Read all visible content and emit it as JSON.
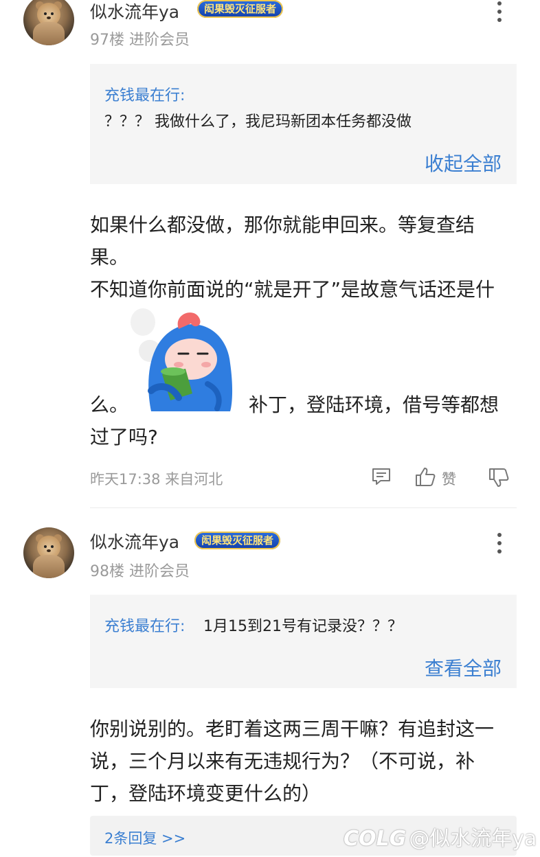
{
  "posts": [
    {
      "username": "似水流年ya",
      "badge": "闳果毁灭征服者",
      "floor": "97楼",
      "level": "进阶会员",
      "quote": {
        "author": "充钱最在行:",
        "text": "？？？ 我做什么了，我尼玛新团本任务都没做",
        "toggle": "收起全部"
      },
      "body_lines": [
        "如果什么都没做，那你就能申回来。等复查结",
        "果。",
        "不知道你前面说的“就是开了”是故意气话还是什",
        "么。",
        "补丁，登陆环境，借号等都想",
        "过了吗?"
      ],
      "time_location": "昨天17:38 来自河北",
      "actions": {
        "comment_icon": "comment-icon",
        "like_icon": "thumbs-up-icon",
        "like_label": "赞",
        "dislike_icon": "thumbs-down-icon"
      }
    },
    {
      "username": "似水流年ya",
      "badge": "闳果毁灭征服者",
      "floor": "98楼",
      "level": "进阶会员",
      "quote": {
        "author": "充钱最在行:",
        "text": "1月15到21号有记录没？？？",
        "toggle": "查看全部"
      },
      "body_lines": [
        "你别说别的。老盯着这两三周干嘛？有追封这一",
        "说，三个月以来有无违规行为？（不可说，补",
        "丁，登陆环境变更什么的）"
      ],
      "replies_link": "2条回复 >>"
    }
  ],
  "watermark": {
    "logo": "COLG",
    "text": "@似水流年ya"
  },
  "colors": {
    "link_blue": "#3b7fd1",
    "meta_gray": "#9a9a9a",
    "quote_bg": "#f5f5f5"
  }
}
